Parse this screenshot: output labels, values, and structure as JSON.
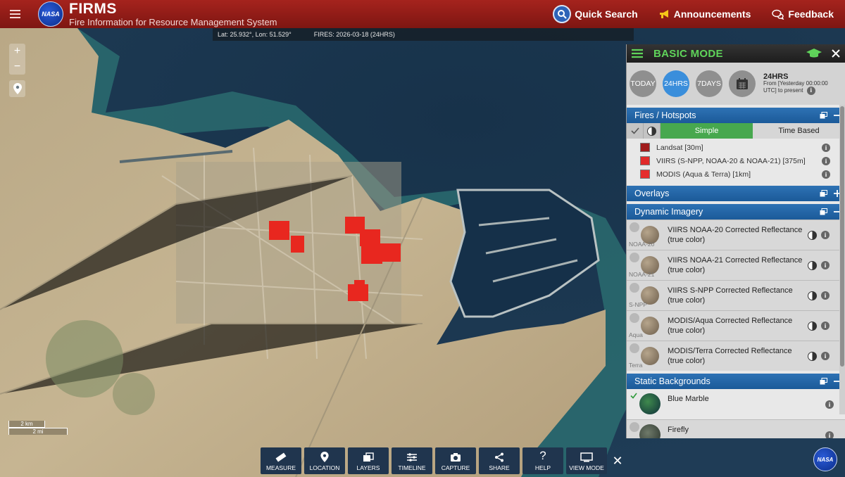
{
  "header": {
    "brand_title": "FIRMS",
    "brand_subtitle": "Fire Information for Resource Management System",
    "logo_text": "NASA",
    "quick_search": "Quick Search",
    "announcements": "Announcements",
    "feedback": "Feedback"
  },
  "map": {
    "coords": "Lat: 25.932°, Lon: 51.529°",
    "fires": "FIRES: 2026-03-18 (24HRS)",
    "scale_km": "2 km",
    "scale_mi": "2 mi",
    "zoom_in": "+",
    "zoom_out": "−"
  },
  "toolbar": {
    "items": [
      {
        "label": "MEASURE"
      },
      {
        "label": "LOCATION"
      },
      {
        "label": "LAYERS"
      },
      {
        "label": "TIMELINE"
      },
      {
        "label": "CAPTURE"
      },
      {
        "label": "SHARE"
      },
      {
        "label": "HELP"
      },
      {
        "label": "VIEW MODE"
      }
    ],
    "close": "✕"
  },
  "panel": {
    "title": "BASIC MODE",
    "time_buttons": [
      "TODAY",
      "24HRS",
      "7DAYS"
    ],
    "time_heading": "24HRS",
    "time_desc_1": "From [Yesterday 00:00:00",
    "time_desc_2": "UTC] to present",
    "fires_section": "Fires / Hotspots",
    "tab_simple": "Simple",
    "tab_time": "Time Based",
    "fire_layers": [
      {
        "name": "Landsat [30m]",
        "color": "#a01c1c"
      },
      {
        "name": "VIIRS (S-NPP, NOAA-20 & NOAA-21) [375m]",
        "color": "#e02a2a"
      },
      {
        "name": "MODIS (Aqua & Terra) [1km]",
        "color": "#e52d2d"
      }
    ],
    "overlays_section": "Overlays",
    "dynamic_section": "Dynamic Imagery",
    "imagery": [
      {
        "thumb": "NOAA-20",
        "name": "VIIRS NOAA-20 Corrected Reflectance (true color)"
      },
      {
        "thumb": "NOAA-21",
        "name": "VIIRS NOAA-21 Corrected Reflectance (true color)"
      },
      {
        "thumb": "S-NPP",
        "name": "VIIRS S-NPP Corrected Reflectance (true color)"
      },
      {
        "thumb": "Aqua",
        "name": "MODIS/Aqua Corrected Reflectance (true color)"
      },
      {
        "thumb": "Terra",
        "name": "MODIS/Terra Corrected Reflectance (true color)"
      }
    ],
    "static_section": "Static Backgrounds",
    "backgrounds": [
      {
        "name": "Blue Marble",
        "checked": true
      },
      {
        "name": "Firefly",
        "checked": false
      }
    ]
  },
  "colors": {
    "header_red": "#8e1a15",
    "panel_title_green": "#5fd45a",
    "section_blue": "#2268a8",
    "active_tab_green": "#47a84e",
    "fire_red": "#e8271f"
  }
}
